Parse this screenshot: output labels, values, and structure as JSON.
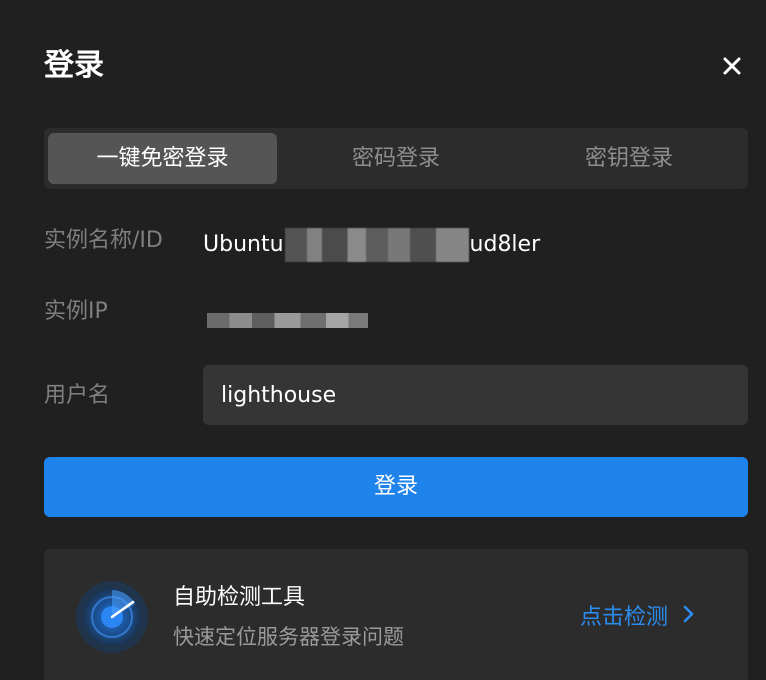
{
  "dialog": {
    "title": "登录",
    "close_icon": "close-icon"
  },
  "tabs": [
    {
      "label": "一键免密登录",
      "active": true
    },
    {
      "label": "密码登录",
      "active": false
    },
    {
      "label": "密钥登录",
      "active": false
    }
  ],
  "fields": {
    "instance_name_label": "实例名称/ID",
    "instance_name_prefix": "Ubuntu",
    "instance_name_suffix": "ud8ler",
    "instance_ip_label": "实例IP",
    "username_label": "用户名",
    "username_value": "lighthouse"
  },
  "login_button": {
    "label": "登录"
  },
  "tool_card": {
    "icon": "radar-icon",
    "title": "自助检测工具",
    "subtitle": "快速定位服务器登录问题",
    "link_label": "点击检测",
    "link_icon": "chevron-right-icon"
  },
  "colors": {
    "background": "#202020",
    "accent": "#1f83ec",
    "link": "#2b8cf0"
  }
}
